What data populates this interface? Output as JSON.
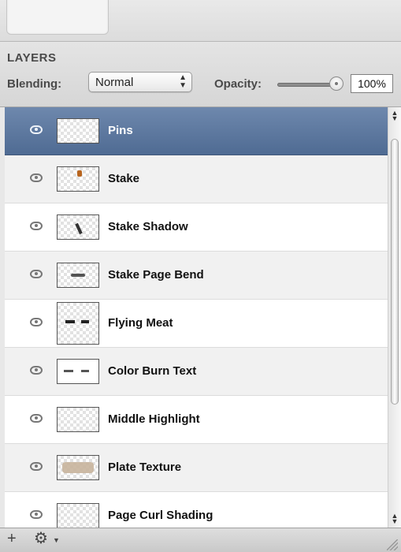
{
  "panel": {
    "title": "LAYERS",
    "blending_label": "Blending:",
    "blending_value": "Normal",
    "opacity_label": "Opacity:",
    "opacity_value": "100%",
    "opacity_fraction": 1.0
  },
  "layers": [
    {
      "name": "Pins",
      "selected": true,
      "visible": true
    },
    {
      "name": "Stake",
      "selected": false,
      "visible": true
    },
    {
      "name": "Stake Shadow",
      "selected": false,
      "visible": true
    },
    {
      "name": "Stake Page Bend",
      "selected": false,
      "visible": true
    },
    {
      "name": "Flying Meat",
      "selected": false,
      "visible": true
    },
    {
      "name": "Color Burn Text",
      "selected": false,
      "visible": true
    },
    {
      "name": "Middle Highlight",
      "selected": false,
      "visible": true
    },
    {
      "name": "Plate Texture",
      "selected": false,
      "visible": true
    },
    {
      "name": "Page Curl Shading",
      "selected": false,
      "visible": true
    }
  ],
  "icons": {
    "visibility": "eye-icon",
    "add": "plus-icon",
    "actions": "gear-icon",
    "resize": "resize-grip-icon"
  },
  "colors": {
    "selected_row": "#5d78a0",
    "row_alt": "#f1f1f1"
  }
}
